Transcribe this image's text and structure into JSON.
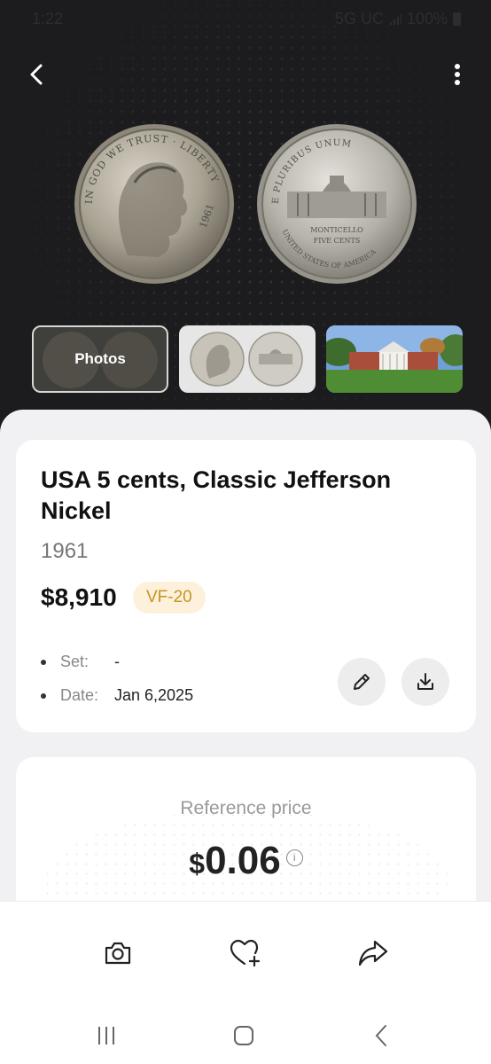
{
  "status_bar": {
    "time": "1:22",
    "network": "5G UC",
    "battery": "100%"
  },
  "header": {
    "back_icon": "arrow-left-icon",
    "more_icon": "kebab-menu-icon"
  },
  "gallery": {
    "coins": [
      {
        "name": "obverse-coin",
        "lettering": "IN GOD WE TRUST  LIBERTY  1961"
      },
      {
        "name": "reverse-coin",
        "lettering": "E PLURIBUS UNUM  MONTICELLO  FIVE CENTS  UNITED STATES OF AMERICA"
      }
    ],
    "thumbnails": [
      {
        "label": "Photos"
      },
      {
        "label": ""
      },
      {
        "label": ""
      }
    ]
  },
  "coin": {
    "title": "USA 5 cents, Classic Jefferson Nickel",
    "year": "1961",
    "price": "$8,910",
    "grade": "VF-20",
    "details": [
      {
        "key": "Set:",
        "value": "-"
      },
      {
        "key": "Date:",
        "value": "Jan 6,2025"
      }
    ]
  },
  "reference": {
    "label": "Reference price",
    "currency": "$",
    "value": "0.06",
    "info_icon": "info-icon"
  },
  "bottom_actions": [
    {
      "name": "camera-icon"
    },
    {
      "name": "heart-plus-icon"
    },
    {
      "name": "share-icon"
    }
  ],
  "colors": {
    "hero_bg": "#1c1c1e",
    "grade_bg": "#fdf1dc",
    "grade_text": "#c9941f",
    "sheet_bg": "#f1f1f3"
  }
}
